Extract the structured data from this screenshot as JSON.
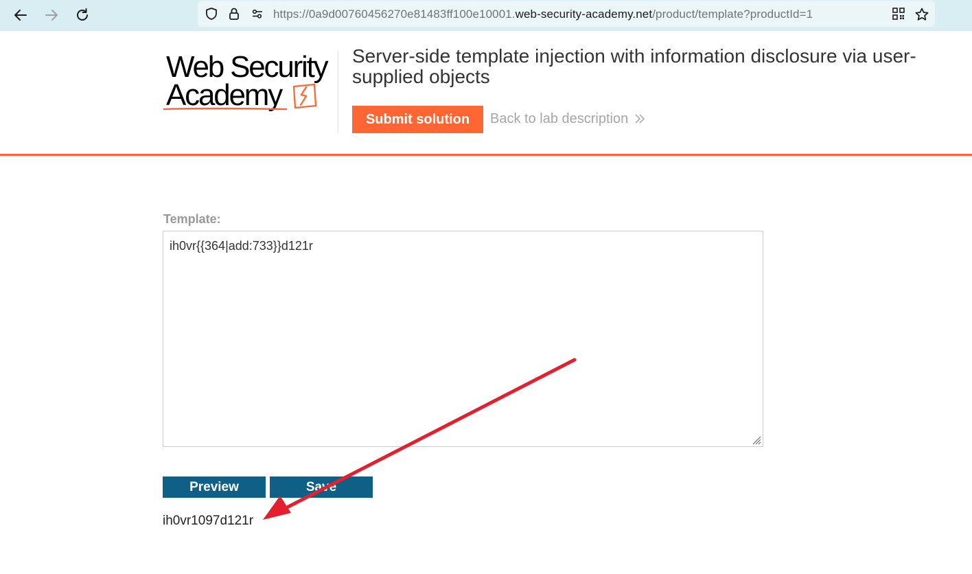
{
  "browser": {
    "url_prefix": "https://0a9d00760456270e81483ff100e10001.",
    "url_domain": "web-security-academy.net",
    "url_path": "/product/template?productId=1",
    "icons": [
      "back-arrow-icon",
      "forward-arrow-icon",
      "reload-icon",
      "shield-icon",
      "lock-icon",
      "permissions-icon",
      "qr-code-icon",
      "star-icon"
    ]
  },
  "header": {
    "logo_line1": "Web Security",
    "logo_line2": "Academy",
    "lab_title": "Server-side template injection with information disclosure via user-supplied objects",
    "submit_label": "Submit solution",
    "back_label": "Back to lab description"
  },
  "main": {
    "template_label": "Template:",
    "template_value": "ih0vr{{364|add:733}}d121r",
    "preview_label": "Preview",
    "save_label": "Save",
    "output": "ih0vr1097d121r"
  },
  "colors": {
    "accent": "#ff6633",
    "button_blue": "#0f5f86",
    "annotation_arrow": "#e5202e"
  }
}
